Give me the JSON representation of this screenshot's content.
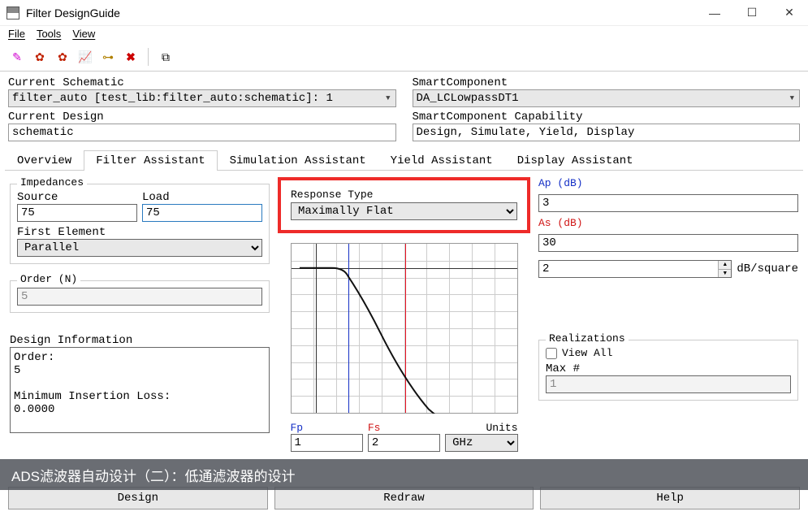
{
  "window": {
    "title": "Filter DesignGuide",
    "min": "—",
    "max": "☐",
    "close": "✕"
  },
  "menu": {
    "file": "File",
    "tools": "Tools",
    "view": "View"
  },
  "top_fields": {
    "cur_schem_label": "Current Schematic",
    "cur_schem": "filter_auto [test_lib:filter_auto:schematic]: 1",
    "smartcomp_label": "SmartComponent",
    "smartcomp": "DA_LCLowpassDT1",
    "cur_design_label": "Current Design",
    "cur_design": "schematic",
    "capability_label": "SmartComponent Capability",
    "capability": "Design, Simulate, Yield, Display"
  },
  "tabs": {
    "overview": "Overview",
    "filter": "Filter Assistant",
    "sim": "Simulation Assistant",
    "yield": "Yield Assistant",
    "display": "Display Assistant"
  },
  "impedances": {
    "title": "Impedances",
    "source_label": "Source",
    "source": "75",
    "load_label": "Load",
    "load": "75",
    "first_el_label": "First Element",
    "first_el": "Parallel"
  },
  "order": {
    "title": "Order (N)",
    "value": "5"
  },
  "design_info": {
    "title": "Design Information",
    "text": "Order:\n5\n\nMinimum Insertion Loss:\n0.0000"
  },
  "response": {
    "label": "Response Type",
    "value": "Maximally Flat"
  },
  "freqs": {
    "fp_label": "Fp",
    "fp": "1",
    "fs_label": "Fs",
    "fs": "2",
    "units_label": "Units",
    "units": "GHz"
  },
  "right": {
    "ap_label": "Ap (dB)",
    "ap": "3",
    "as_label": "As (dB)",
    "as": "30",
    "dbsq": "2",
    "dbsq_suffix": "dB/square",
    "realiz_title": "Realizations",
    "view_all": "View All",
    "maxn_label": "Max #",
    "maxn": "1"
  },
  "buttons": {
    "design": "Design",
    "redraw": "Redraw",
    "help": "Help"
  },
  "caption": "ADS滤波器自动设计（二）：低通滤波器的设计",
  "chart_data": {
    "type": "line",
    "title": "",
    "xlabel": "",
    "ylabel": "",
    "markers": {
      "Fp": 1,
      "Fs": 2
    },
    "note": "Lowpass magnitude response; flat to Fp then monotonic roll-off",
    "x": [
      0.0,
      0.5,
      0.8,
      1.0,
      1.2,
      1.5,
      1.8,
      2.0,
      2.4,
      2.8
    ],
    "values": [
      0,
      -0.1,
      -0.5,
      -3,
      -7,
      -15,
      -24,
      -30,
      -42,
      -55
    ],
    "xlim": [
      0,
      3
    ],
    "ylim": [
      -60,
      5
    ]
  }
}
